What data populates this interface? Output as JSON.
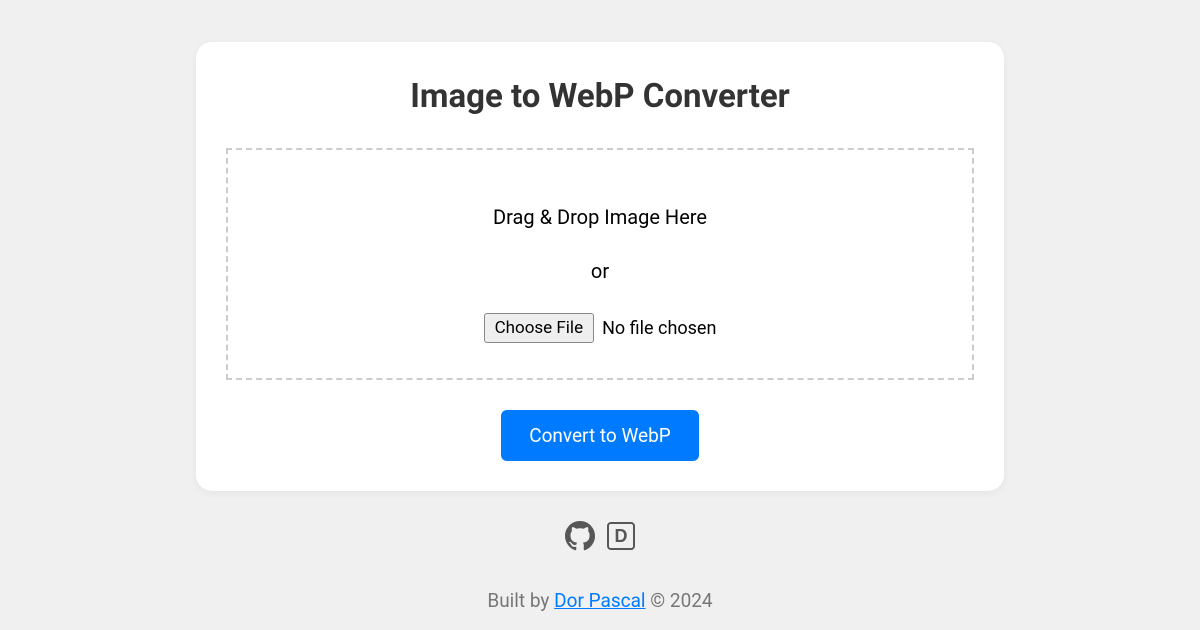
{
  "title": "Image to WebP Converter",
  "dropzone": {
    "drop_text": "Drag & Drop Image Here",
    "or_text": "or",
    "choose_file_label": "Choose File",
    "file_status": "No file chosen"
  },
  "convert_button_label": "Convert to WebP",
  "icons": {
    "github": "github-icon",
    "site": "D"
  },
  "footer": {
    "built_by_prefix": "Built by ",
    "author": "Dor Pascal",
    "copyright": " © 2024"
  }
}
